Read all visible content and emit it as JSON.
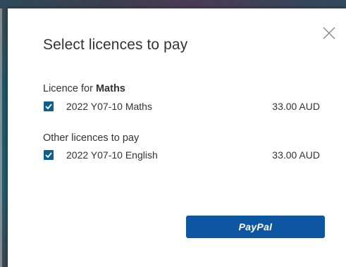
{
  "dialog": {
    "title": "Select licences to pay",
    "close_icon": "close-icon"
  },
  "subject_section": {
    "label_prefix": "Licence for ",
    "label_subject": "Maths",
    "items": [
      {
        "label": "2022 Y07-10 Maths",
        "price": "33.00 AUD",
        "checked": true
      }
    ]
  },
  "other_section": {
    "label": "Other licences to pay",
    "items": [
      {
        "label": "2022 Y07-10 English",
        "price": "33.00 AUD",
        "checked": true
      }
    ]
  },
  "actions": {
    "paypal_label": "PayPal"
  },
  "colors": {
    "checkbox": "#0f5f8e",
    "paypal_button": "#0d56a1",
    "text": "#333333",
    "backdrop": "#2d4654"
  }
}
